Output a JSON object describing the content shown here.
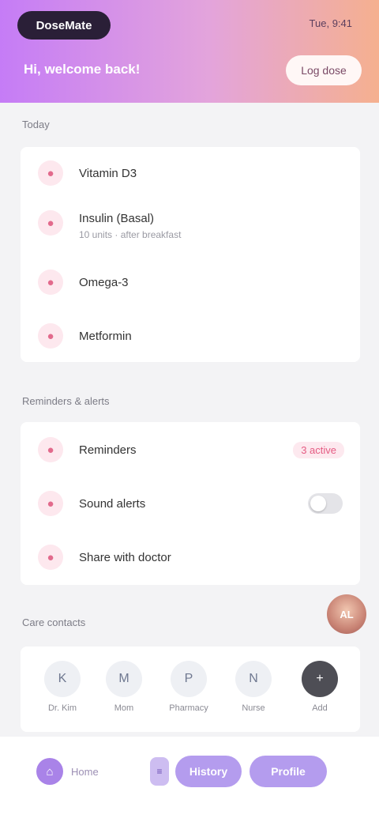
{
  "header": {
    "brand": "DoseMate",
    "meta": "Tue, 9:41",
    "title": "Hi, welcome back!",
    "button_label": "Log dose"
  },
  "sections": {
    "today_label": "Today",
    "settings_label": "Reminders & alerts",
    "contacts_label": "Care contacts"
  },
  "today_items": [
    {
      "icon": "pill-icon",
      "glyph": "●",
      "title": "Vitamin D3"
    },
    {
      "icon": "syringe-icon",
      "glyph": "●",
      "title": "Insulin (Basal)",
      "subtitle": "10 units · after breakfast"
    },
    {
      "icon": "capsule-icon",
      "glyph": "●",
      "title": "Omega-3"
    },
    {
      "icon": "tablet-icon",
      "glyph": "●",
      "title": "Metformin"
    }
  ],
  "settings_items": [
    {
      "icon": "bell-icon",
      "glyph": "●",
      "title": "Reminders",
      "badge": "3 active"
    },
    {
      "icon": "sound-icon",
      "glyph": "●",
      "title": "Sound alerts",
      "toggle_on": false
    },
    {
      "icon": "share-icon",
      "glyph": "●",
      "title": "Share with doctor"
    }
  ],
  "avatar_initials": "AL",
  "contacts": [
    {
      "name": "Dr. Kim",
      "initial": "K"
    },
    {
      "name": "Mom",
      "initial": "M"
    },
    {
      "name": "Pharmacy",
      "initial": "P"
    },
    {
      "name": "Nurse",
      "initial": "N"
    },
    {
      "name": "Add",
      "initial": "+"
    }
  ],
  "nav": {
    "home_label": "Home",
    "small_label": "≡",
    "pill_1": "History",
    "pill_2": "Profile"
  }
}
